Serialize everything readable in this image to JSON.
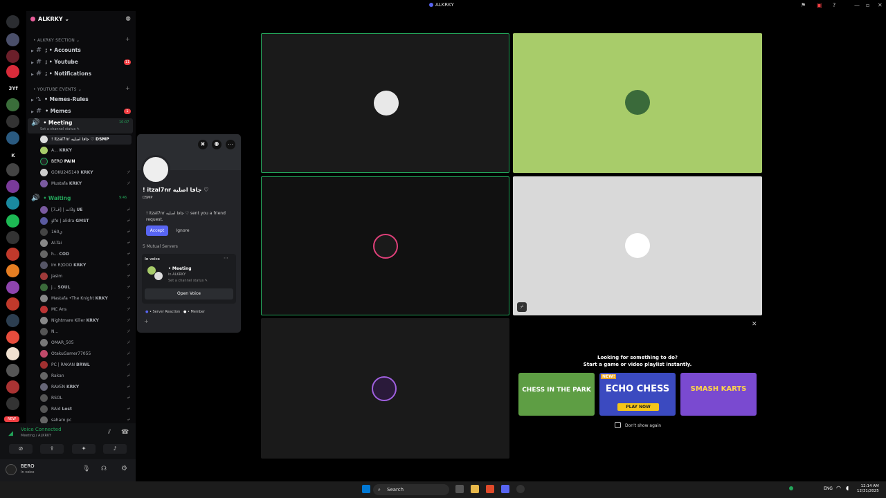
{
  "window": {
    "title": "ALKRKY"
  },
  "server": {
    "name": "ALKRKY ⌄",
    "categories": [
      {
        "label": "• ALKRKY SECTION ⌄"
      },
      {
        "label": "• YOUTUBE EVENTS ⌄"
      }
    ],
    "channels": [
      {
        "label": "; • Accounts"
      },
      {
        "label": "; • Youtube",
        "badge": "11"
      },
      {
        "label": "; • Notifications"
      },
      {
        "label": "• Memes-Rules"
      },
      {
        "label": "• Memes",
        "badge": "1"
      },
      {
        "label": "• Meeting",
        "time": "10:07",
        "status": "Set a channel status ✎"
      }
    ],
    "meeting_users": [
      {
        "name": "! itzal7nr جافا اصليه ♡",
        "tag": "DSMP"
      },
      {
        "name": "A...",
        "tag": "KRKY"
      },
      {
        "name": "BERO",
        "tag": "PAIN"
      },
      {
        "name": "GOKU245149",
        "tag": "KRKY"
      },
      {
        "name": "Mustafa",
        "tag": "KRKY"
      }
    ],
    "waiting_channel": {
      "label": "• Waiting",
      "time": "9:46"
    },
    "waiting_users": [
      {
        "name": "ؤ3ات | [ڦ7]",
        "tag": "UE"
      },
      {
        "name": "ؤIfe | alidra",
        "tag": "GMST"
      },
      {
        "name": "ي160"
      },
      {
        "name": "Al-Tai"
      },
      {
        "name": "h...",
        "tag": "COD"
      },
      {
        "name": "Im R]OOO",
        "tag": "KRKY"
      },
      {
        "name": "Jasim"
      },
      {
        "name": "j...",
        "tag": "SOUL"
      },
      {
        "name": "Mastafa •The Knight",
        "tag": "KRKY"
      },
      {
        "name": "MC Ans"
      },
      {
        "name": "Nightmare Killer",
        "tag": "KRKY"
      },
      {
        "name": "N..."
      },
      {
        "name": "OMAR_505"
      },
      {
        "name": "OtakuGamer77055"
      },
      {
        "name": "PC | RAKAN",
        "tag": "BRWL"
      },
      {
        "name": "Rakan"
      },
      {
        "name": "RAVEN",
        "tag": "KRKY"
      },
      {
        "name": "RSOL"
      },
      {
        "name": "RAid",
        "tag": "Lost"
      },
      {
        "name": "saharo pc"
      }
    ]
  },
  "voice_panel": {
    "title": "Voice Connected",
    "subtitle": "Meeting / ALKRKY"
  },
  "user_bar": {
    "name": "BERO",
    "status": "In voice"
  },
  "profile_popup": {
    "name": "! itzal7nr جافا اصليه ♡",
    "sub": "DSMP",
    "request": "! itzal7nr جافا اصليه ♡ sent you a friend request.",
    "accept": "Accept",
    "ignore": "Ignore",
    "mutual": "5 Mutual Servers",
    "in_voice_label": "In voice",
    "voice_channel": "• Meeting",
    "voice_server": "in ALKRKY",
    "voice_status": "Set a channel status ✎",
    "open_voice": "Open Voice",
    "roles": "• Server Reaction",
    "roles2": "• Member"
  },
  "activity": {
    "line1": "Looking for something to do?",
    "line2": "Start a game or video playlist instantly.",
    "cards": [
      {
        "title": "CHESS IN THE PARK"
      },
      {
        "title": "ECHO CHESS",
        "sub": "PLAY NOW",
        "badge": "NEW!"
      },
      {
        "title": "SMASH KARTS"
      }
    ],
    "dont_show": "Don't show again"
  },
  "taskbar": {
    "search": "Search",
    "lang": "ENG",
    "time": "12:14 AM",
    "date": "12/31/2025"
  },
  "colors": {
    "accent": "#5865f2",
    "voice_green": "#23a55a",
    "tile_green": "#a8cc6a",
    "tile_gray": "#d9d9d9"
  }
}
